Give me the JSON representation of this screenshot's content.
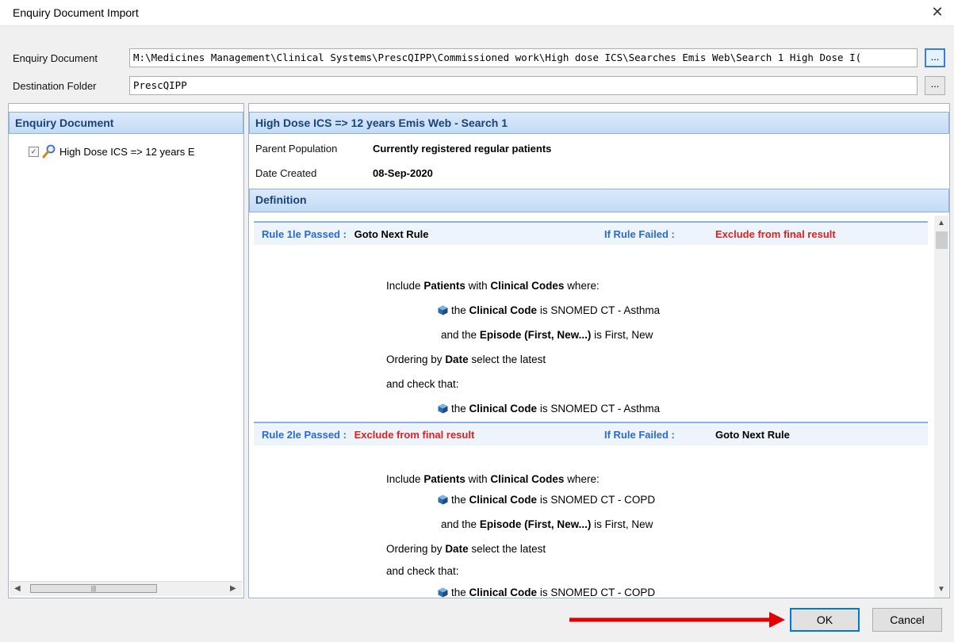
{
  "window": {
    "title": "Enquiry Document Import",
    "close_glyph": "✕"
  },
  "form": {
    "enquiry_document_label": "Enquiry Document",
    "enquiry_document_value": "M:\\Medicines Management\\Clinical Systems\\PrescQIPP\\Commissioned work\\High dose ICS\\Searches Emis Web\\Search 1 High Dose I(",
    "destination_folder_label": "Destination Folder",
    "destination_folder_value": "PrescQIPP",
    "browse_label": "..."
  },
  "left_pane": {
    "header": "Enquiry Document",
    "tree_item": "High Dose ICS => 12 years E",
    "checked": true
  },
  "right_pane": {
    "header": "High Dose ICS => 12 years Emis Web - Search 1",
    "parent_population_label": "Parent Population",
    "parent_population_value": "Currently registered regular patients",
    "date_created_label": "Date Created",
    "date_created_value": "08-Sep-2020",
    "definition_header": "Definition"
  },
  "rules": [
    {
      "title": "Rule 1le Passed :",
      "passed_action": "Goto Next Rule",
      "failed_label": "If Rule Failed :",
      "failed_action": "Exclude from final result",
      "include_prefix": "Include",
      "include_patients": "Patients",
      "include_with": "with",
      "include_codes": "Clinical Codes",
      "include_where": "where:",
      "code_the": "the",
      "code_label": "Clinical Code",
      "code_is": "is",
      "code_value": "SNOMED CT - Asthma",
      "episode_and": "and the",
      "episode_label": "Episode (First, New...)",
      "episode_is": "is",
      "episode_value": "First, New",
      "ordering_prefix": "Ordering by",
      "ordering_field": "Date",
      "ordering_suffix": "select the latest",
      "check_text": "and check that:",
      "check_the": "the",
      "check_label": "Clinical Code",
      "check_is": "is",
      "check_value": "SNOMED CT - Asthma"
    },
    {
      "title": "Rule 2le Passed :",
      "passed_action": "Exclude from final result",
      "failed_label": "If Rule Failed :",
      "failed_action": "Goto Next Rule",
      "include_prefix": "Include",
      "include_patients": "Patients",
      "include_with": "with",
      "include_codes": "Clinical Codes",
      "include_where": "where:",
      "code_the": "the",
      "code_label": "Clinical Code",
      "code_is": "is",
      "code_value": "SNOMED CT - COPD",
      "episode_and": "and the",
      "episode_label": "Episode (First, New...)",
      "episode_is": "is",
      "episode_value": "First, New",
      "ordering_prefix": "Ordering by",
      "ordering_field": "Date",
      "ordering_suffix": "select the latest",
      "check_text": "and check that:",
      "check_the": "the",
      "check_label": "Clinical Code",
      "check_is": "is",
      "check_value": "SNOMED CT - COPD"
    }
  ],
  "buttons": {
    "ok": "OK",
    "cancel": "Cancel"
  },
  "colors": {
    "accent": "#0078d7",
    "header_text": "#17447a",
    "pass_blue": "#2a6ad6",
    "fail_red": "#e02020",
    "arrow_red": "#e00000"
  }
}
